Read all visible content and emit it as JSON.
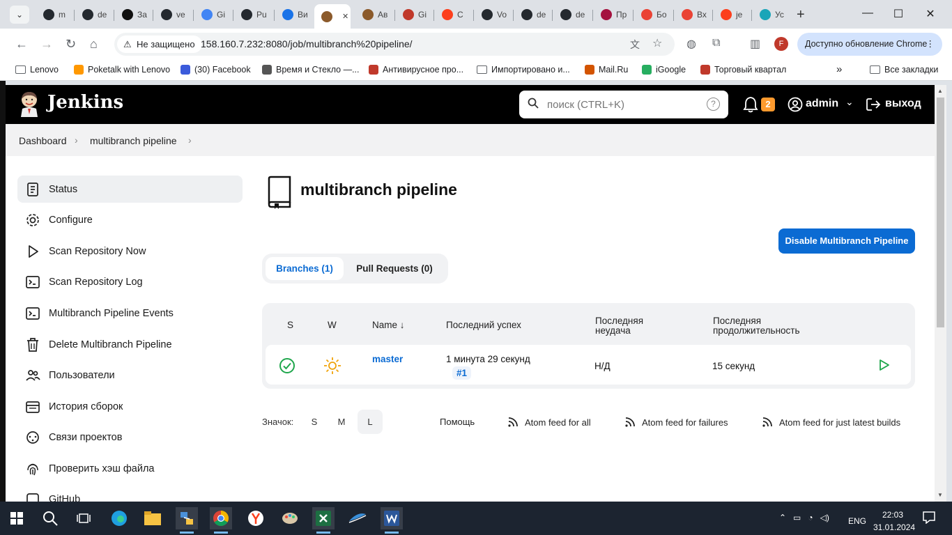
{
  "browser": {
    "tabs": [
      {
        "label": "m",
        "color": "#24292f"
      },
      {
        "label": "de",
        "color": "#24292f"
      },
      {
        "label": "За",
        "color": "#111111"
      },
      {
        "label": "ve",
        "color": "#24292f"
      },
      {
        "label": "Gi",
        "color": "#4285f4"
      },
      {
        "label": "Pu",
        "color": "#24292f"
      },
      {
        "label": "Ви",
        "color": "#1a73e8"
      },
      {
        "label": "",
        "color": "#8b5a2b"
      },
      {
        "label": "Ав",
        "color": "#8b5a2b"
      },
      {
        "label": "Gi",
        "color": "#c0392b"
      },
      {
        "label": "С",
        "color": "#fc3f1d"
      },
      {
        "label": "Vo",
        "color": "#24292f"
      },
      {
        "label": "de",
        "color": "#24292f"
      },
      {
        "label": "de",
        "color": "#24292f"
      },
      {
        "label": "Пр",
        "color": "#a4123f"
      },
      {
        "label": "Бо",
        "color": "#ea4335"
      },
      {
        "label": "Вх",
        "color": "#ea4335"
      },
      {
        "label": "je",
        "color": "#fc3f1d"
      },
      {
        "label": "Ус",
        "color": "#1aa5b8"
      }
    ],
    "tab_close": "✕",
    "new_tab": "+",
    "security_label": "Не защищено",
    "url": "158.160.7.232:8080/job/multibranch%20pipeline/",
    "update_label": "Доступно обновление Chrome",
    "profile_initial": "F",
    "bookmarks": [
      {
        "label": "Lenovo",
        "icon": "folder-icon"
      },
      {
        "label": "Poketalk with Lenovo",
        "icon": "poketalk-icon"
      },
      {
        "label": "(30) Facebook",
        "icon": "facebook-icon"
      },
      {
        "label": "Время и Стекло —...",
        "icon": "globe-icon"
      },
      {
        "label": "Антивирусное про...",
        "icon": "mcafee-icon"
      },
      {
        "label": "Импортировано и...",
        "icon": "folder-icon"
      },
      {
        "label": "Mail.Ru",
        "icon": "mailru-icon"
      },
      {
        "label": "iGoogle",
        "icon": "igoogle-icon"
      },
      {
        "label": "Торговый квартал",
        "icon": "mcafee-icon"
      }
    ],
    "bookmarks_more": "»",
    "all_bookmarks": "Все закладки"
  },
  "jenkins": {
    "brand": "Jenkins",
    "search_placeholder": "поиск (CTRL+K)",
    "help": "?",
    "notifications_count": "2",
    "user": "admin",
    "logout": "выход",
    "breadcrumb": [
      "Dashboard",
      "multibranch pipeline"
    ],
    "sidebar": [
      {
        "label": "Status",
        "icon": "status-icon"
      },
      {
        "label": "Configure",
        "icon": "gear-icon"
      },
      {
        "label": "Scan Repository Now",
        "icon": "play-icon"
      },
      {
        "label": "Scan Repository Log",
        "icon": "terminal-icon"
      },
      {
        "label": "Multibranch Pipeline Events",
        "icon": "terminal-icon"
      },
      {
        "label": "Delete Multibranch Pipeline",
        "icon": "trash-icon"
      },
      {
        "label": "Пользователи",
        "icon": "people-icon"
      },
      {
        "label": "История сборок",
        "icon": "history-icon"
      },
      {
        "label": "Связи проектов",
        "icon": "relations-icon"
      },
      {
        "label": "Проверить хэш файла",
        "icon": "fingerprint-icon"
      },
      {
        "label": "GitHub",
        "icon": "github-icon"
      }
    ],
    "page_title": "multibranch pipeline",
    "disable_button": "Disable Multibranch Pipeline",
    "tabs": {
      "branches": "Branches (1)",
      "pull_requests": "Pull Requests (0)"
    },
    "table": {
      "headers": {
        "s": "S",
        "w": "W",
        "name": "Name ↓",
        "last_success": "Последний успех",
        "last_failure_1": "Последняя",
        "last_failure_2": "неудача",
        "last_duration_1": "Последняя",
        "last_duration_2": "продолжительность"
      },
      "rows": [
        {
          "status": "success",
          "weather": "sunny",
          "name": "master",
          "last_success": "1 минута 29 секунд",
          "build": "#1",
          "last_failure": "Н/Д",
          "last_duration": "15 секунд"
        }
      ]
    },
    "icon_label": "Значок:",
    "icon_sizes": [
      "S",
      "M",
      "L"
    ],
    "icon_size_selected": "L",
    "help_link": "Помощь",
    "feeds": [
      "Atom feed for all",
      "Atom feed for failures",
      "Atom feed for just latest builds"
    ]
  },
  "taskbar": {
    "lang": "ENG",
    "time": "22:03",
    "date": "31.01.2024"
  },
  "colors": {
    "accent": "#0b6bd3",
    "success": "#1ea64b",
    "header": "#000000",
    "badge": "#fe9a2e"
  }
}
